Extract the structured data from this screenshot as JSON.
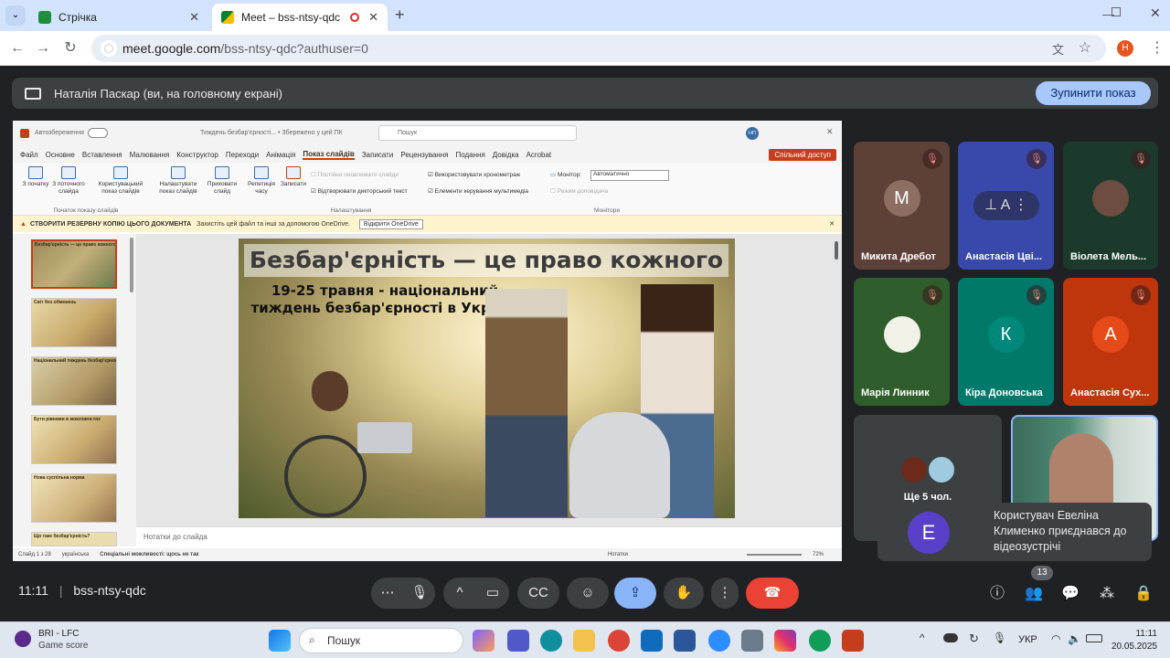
{
  "browser": {
    "tabs": [
      {
        "label": "Стрічка",
        "close": "✕"
      },
      {
        "label": "Meet – bss-ntsy-qdc",
        "close": "✕"
      }
    ],
    "new_tab": "+",
    "url_host": "meet.google.com",
    "url_path": "/bss-ntsy-qdc?authuser=0",
    "profile_initial": "Н"
  },
  "presenting": {
    "text": "Наталія Паскар (ви, на головному екрані)",
    "stop_label": "Зупинити показ"
  },
  "ppt": {
    "autosave": "Автозбереження",
    "doc_title": "Тиждень безбар'єрності...  •  Збережено у цей ПК",
    "search": "Пошук",
    "user_initials": "НП",
    "share_label": "Спільний доступ",
    "menu": [
      "Файл",
      "Основне",
      "Вставлення",
      "Малювання",
      "Конструктор",
      "Переходи",
      "Анімація",
      "Показ слайдів",
      "Записати",
      "Рецензування",
      "Подання",
      "Довідка",
      "Acrobat"
    ],
    "selected_menu": "Показ слайдів",
    "ribbon": {
      "from_start": "З початку",
      "from_current": "З поточного слайда",
      "custom_show": "Користувацький показ слайдів",
      "group1": "Початок показу слайдів",
      "setup": "Налаштувати показ слайдів",
      "hide": "Приховати слайд",
      "rehearse": "Репетиція часу",
      "record": "Записати",
      "keep_updated": "Постійно оновлювати слайди",
      "play_narration": "Відтворювати дикторський текст",
      "use_timings": "Використовувати хронометраж",
      "media_controls": "Елементи керування мультимедіа",
      "group2": "Налаштування",
      "monitor_label": "Монітор:",
      "monitor_value": "Автоматично",
      "presenter_view": "Режим доповідача",
      "group3": "Монітори"
    },
    "warning": "СТВОРИТИ РЕЗЕРВНУ КОПІЮ ЦЬОГО ДОКУМЕНТА",
    "warning_detail": "Захистіть цей файл та інші за допомогою OneDrive.",
    "warning_button": "Відкрити OneDrive",
    "thumbnails": [
      {
        "num": "1",
        "caption": "Безбар'єрність — це право кожного"
      },
      {
        "num": "2",
        "caption": "Світ без обмежень"
      },
      {
        "num": "3",
        "caption": "Національний тиждень безбар'єрності"
      },
      {
        "num": "4",
        "caption": "Бути рівними в можливостях"
      },
      {
        "num": "5",
        "caption": "Нова суспільна норма"
      },
      {
        "num": "6",
        "caption": "Що таке безбар'єрність?"
      }
    ],
    "slide_title": "Безбар'єрність — це право кожного",
    "slide_subtitle": "19-25 травня - національний тиждень безбар'єрності в Україні",
    "notes": "Нотатки до слайда",
    "status_slide": "Слайд 1 з 28",
    "status_lang": "українська",
    "status_access": "Спеціальні можливості: щось не так",
    "status_notes": "Нотатки",
    "zoom": "72%"
  },
  "participants": [
    {
      "name": "Микита Дребот",
      "initial": "М",
      "color": "#7b5a4f"
    },
    {
      "name": "Анастасія Цвi...",
      "initial": "А",
      "color": "#3949ab"
    },
    {
      "name": "Віолета Мель...",
      "initial": "",
      "color": "#1b3a2b"
    },
    {
      "name": "Марія Линник",
      "initial": "",
      "color": "#2f5d2b"
    },
    {
      "name": "Кіра Доновська",
      "initial": "К",
      "color": "#00796b"
    },
    {
      "name": "Анастасія Сух...",
      "initial": "А",
      "color": "#bf360c"
    }
  ],
  "more_tile": "Ще 5 чол.",
  "toast": {
    "initial": "Е",
    "text": "Користувач Евеліна Клименко приєднався до відеозустрічі"
  },
  "meetbar": {
    "time": "11:11",
    "code": "bss-ntsy-qdc",
    "people_count": "13"
  },
  "taskbar": {
    "weather_title": "BRI - LFC",
    "weather_sub": "Game score",
    "search": "Пошук",
    "lang": "УКР",
    "time": "11:11",
    "date": "20.05.2025"
  }
}
